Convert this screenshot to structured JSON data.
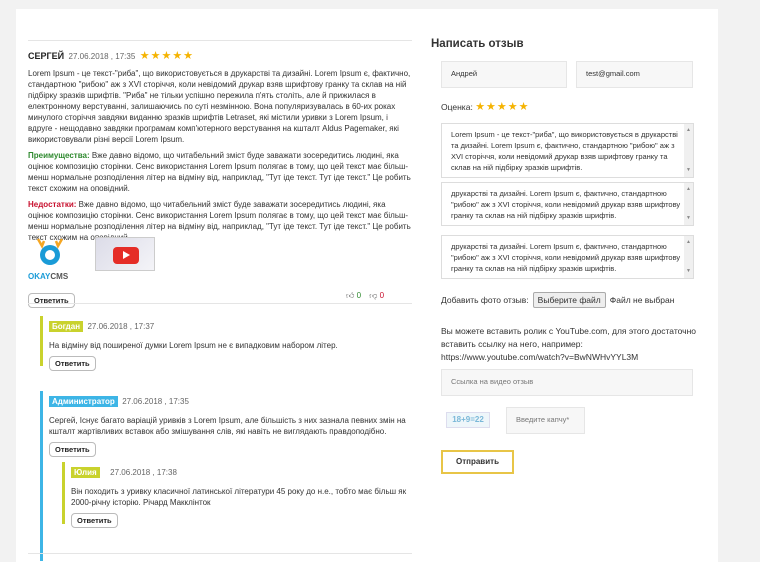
{
  "review": {
    "author": "СЕРГЕЙ",
    "date": "27.06.2018 , 17:35",
    "stars": "★★★★★",
    "text": "Lorem Ipsum - це текст-\"риба\", що використовується в друкарстві та дизайні. Lorem Ipsum є, фактично, стандартною \"рибою\" аж з XVI сторіччя, коли невідомий друкар взяв шрифтову гранку та склав на ній підбірку зразків шрифтів. \"Риба\" не тільки успішно пережила п'ять століть, але й прижилася в електронному верстуванні, залишаючись по суті незмінною. Вона популяризувалась в 60-их роках минулого сторіччя завдяки виданню зразків шрифтів Letraset, які містили уривки з Lorem Ipsum, і вдруге - нещодавно завдяки програмам комп'ютерного верстування на кшталт Aldus Pagemaker, які використовували різні версії Lorem Ipsum.",
    "pros_label": "Преимущества:",
    "pros_text": "Вже давно відомо, що читабельний зміст буде заважати зосередитись людині, яка оцінює композицію сторінки. Сенс використання Lorem Ipsum полягає в тому, що цей текст має більш-менш нормальне розподілення літер на відміну від, наприклад, \"Тут іде текст. Тут іде текст.\" Це робить текст схожим на оповідний.",
    "cons_label": "Недостатки:",
    "cons_text": "Вже давно відомо, що читабельний зміст буде заважати зосередитись людині, яка оцінює композицію сторінки. Сенс використання Lorem Ipsum полягає в тому, що цей текст має більш-менш нормальне розподілення літер на відміну від, наприклад, \"Тут іде текст. Тут іде текст.\" Це робить текст схожим на оповідний.",
    "logo_text_a": "OKAY",
    "logo_text_b": "CMS",
    "reply_label": "Ответить",
    "likes": "0",
    "dislikes": "0"
  },
  "replies": [
    {
      "author": "Богдан",
      "date": "27.06.2018 , 17:37",
      "text": "На відміну від поширеної думки Lorem Ipsum не є випадковим набором літер.",
      "reply_label": "Ответить"
    },
    {
      "author": "Администратор",
      "date": "27.06.2018 , 17:35",
      "text": "Сергей, Існує багато варіацій уривків з Lorem Ipsum, але більшість з них зазнала певних змін на кшталт жартівливих вставок або змішування слів, які навіть не виглядають правдоподібно.",
      "reply_label": "Ответить"
    },
    {
      "author": "Юлия",
      "date": "27.06.2018 , 17:38",
      "text": "Він походить з уривку класичної латинської літератури 45 року до н.е., тобто має більш як 2000-річну історію. Річард Макклінток",
      "reply_label": "Ответить"
    }
  ],
  "form": {
    "title": "Написать отзыв",
    "name_value": "Андрей",
    "email_value": "test@gmail.com",
    "rating_label": "Оценка:",
    "rating_stars": "★★★★★",
    "textarea1": "Lorem Ipsum - це текст-\"риба\", що використовується в друкарстві та дизайні. Lorem Ipsum є, фактично, стандартною \"рибою\" аж з XVI сторіччя, коли невідомий друкар взяв шрифтову гранку та склав на ній підбірку зразків шрифтів.",
    "textarea2": "друкарстві та дизайні. Lorem Ipsum є, фактично, стандартною \"рибою\" аж з XVI сторіччя, коли невідомий друкар взяв шрифтову гранку та склав на ній підбірку зразків шрифтів.",
    "textarea3": "друкарстві та дизайні. Lorem Ipsum є, фактично, стандартною \"рибою\" аж з XVI сторіччя, коли невідомий друкар взяв шрифтову гранку та склав на ній підбірку зразків шрифтів.",
    "photo_label": "Добавить фото отзыв:",
    "file_button": "Выберите файл",
    "file_status": "Файл не выбран",
    "youtube_hint": "Вы можете вставить ролик с YouTube.com, для этого достаточно вставить ссылку на него, например: https://www.youtube.com/watch?v=BwNWHvYYL3M",
    "video_placeholder": "Ссылка на видео отзыв",
    "captcha_code": "18+9=22",
    "captcha_placeholder": "Введите капчу*",
    "submit_label": "Отправить"
  },
  "colors": {
    "accent_star": "#f5b301",
    "pros": "#2f8a2f",
    "cons": "#c8102e",
    "reply_border": "#c9d22d",
    "admin_border": "#3db5e6",
    "submit_border": "#e8c547"
  }
}
